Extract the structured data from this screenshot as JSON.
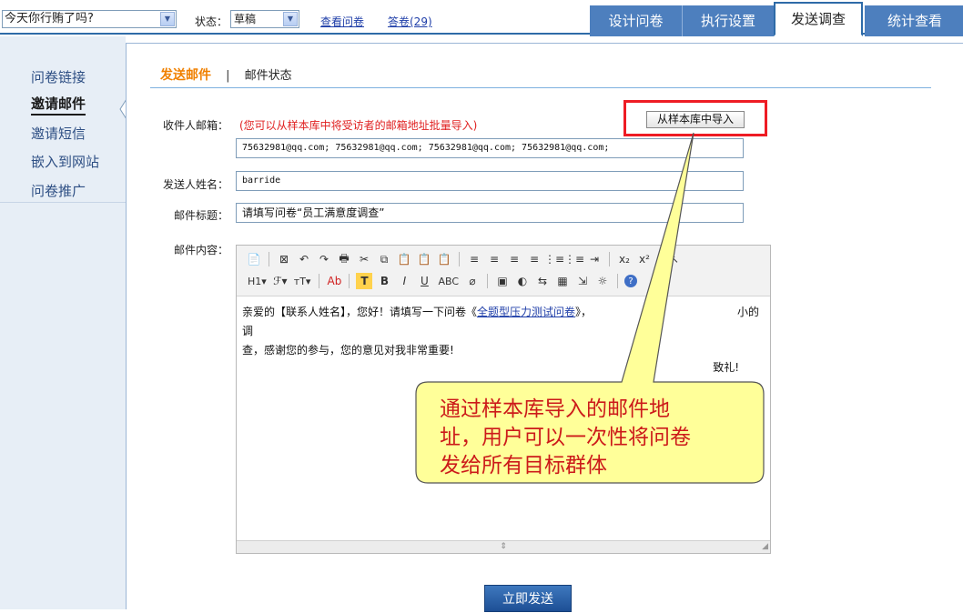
{
  "top": {
    "survey_select_value": "今天你行贿了吗?",
    "status_label": "状态：",
    "status_value": "草稿",
    "link_view": "查看问卷",
    "link_answers": "答卷(29)",
    "tabs": [
      "设计问卷",
      "执行设置",
      "发送调查",
      "统计查看"
    ],
    "active_tab": "发送调查"
  },
  "sidebar": {
    "items": [
      "问卷链接",
      "邀请邮件",
      "邀请短信",
      "嵌入到网站",
      "问卷推广"
    ],
    "active": "邀请邮件"
  },
  "subnav": {
    "active": "发送邮件",
    "separator": "|",
    "other": "邮件状态"
  },
  "form": {
    "recipient_label": "收件人邮箱：",
    "recipient_hint": "(您可以从样本库中将受访者的邮箱地址批量导入)",
    "import_button": "从样本库中导入",
    "recipient_value": "75632981@qq.com;  75632981@qq.com;  75632981@qq.com;  75632981@qq.com;",
    "sender_label": "发送人姓名：",
    "sender_value": "barride",
    "subject_label": "邮件标题：",
    "subject_value": "请填写问卷“员工满意度调查”",
    "content_label": "邮件内容："
  },
  "editor": {
    "body_prefix": "亲爱的【联系人姓名】，您好！请填写一下问卷《",
    "body_link": "全题型压力测试问卷",
    "body_suffix": "》，",
    "body_suffix_tail": "小的调",
    "body_line2": "查，感谢您的参与，您的意见对我非常重要!",
    "closing": "致礼!",
    "toolbar_row1": [
      "📄",
      "⊠",
      "↶",
      "↷",
      "🖶",
      "✂",
      "⧉",
      "📋",
      "📋",
      "📋",
      "≡",
      "≡",
      "≡",
      "≡",
      "⋮≡",
      "⋮≡",
      "⇥",
      "x₂",
      "x²",
      "↖"
    ],
    "toolbar_row2": [
      "H1▾",
      "ℱ▾",
      "тT▾",
      "Ab",
      "T",
      "B",
      "I",
      "U",
      "ABC",
      "⌀",
      "▣",
      "◐",
      "⇆",
      "▦",
      "⇲",
      "☼",
      "?"
    ]
  },
  "send_button": "立即发送",
  "callout": {
    "lines": [
      "通过样本库导入的邮件地",
      "址，用户可以一次性将问卷",
      "发给所有目标群体"
    ]
  }
}
